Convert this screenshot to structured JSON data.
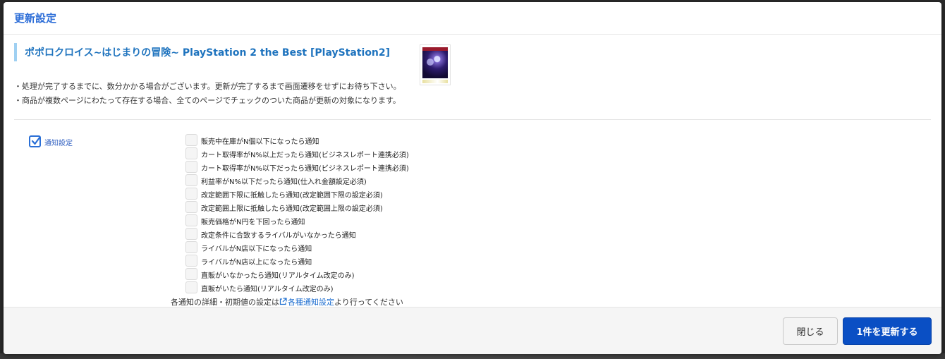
{
  "modal": {
    "title": "更新設定",
    "product_title": "ポポロクロイス~はじまりの冒険~ PlayStation 2 the Best [PlayStation2]",
    "notes": [
      "・処理が完了するまでに、数分かかる場合がございます。更新が完了するまで画面遷移をせずにお待ち下さい。",
      "・商品が複数ページにわたって存在する場合、全てのページでチェックのついた商品が更新の対象になります。"
    ]
  },
  "notify": {
    "label": "通知設定",
    "checked": true,
    "accent_color": "#2a6fd6"
  },
  "options": [
    {
      "label": "販売中在庫がN個以下になったら通知",
      "checked": false
    },
    {
      "label": "カート取得率がN%以上だったら通知(ビジネスレポート連携必須)",
      "checked": false
    },
    {
      "label": "カート取得率がN%以下だったら通知(ビジネスレポート連携必須)",
      "checked": false
    },
    {
      "label": "利益率がN%以下だったら通知(仕入れ金額設定必須)",
      "checked": false
    },
    {
      "label": "改定範囲下限に抵触したら通知(改定範囲下限の設定必須)",
      "checked": false
    },
    {
      "label": "改定範囲上限に抵触したら通知(改定範囲上限の設定必須)",
      "checked": false
    },
    {
      "label": "販売価格がN円を下回ったら通知",
      "checked": false
    },
    {
      "label": "改定条件に合致するライバルがいなかったら通知",
      "checked": false
    },
    {
      "label": "ライバルがN店以下になったら通知",
      "checked": false
    },
    {
      "label": "ライバルがN店以上になったら通知",
      "checked": false
    },
    {
      "label": "直販がいなかったら通知(リアルタイム改定のみ)",
      "checked": false
    },
    {
      "label": "直販がいたら通知(リアルタイム改定のみ)",
      "checked": false
    }
  ],
  "settings_note": {
    "prefix": "各通知の詳細・初期値の設定は",
    "link": "各種通知設定",
    "suffix": "より行ってください"
  },
  "footer": {
    "close_label": "閉じる",
    "update_label": "1件を更新する"
  },
  "colors": {
    "title": "#2f6fd8",
    "product_title": "#1e73be",
    "accent_bar": "#9fd0f2",
    "primary_button": "#0a4fc4"
  }
}
